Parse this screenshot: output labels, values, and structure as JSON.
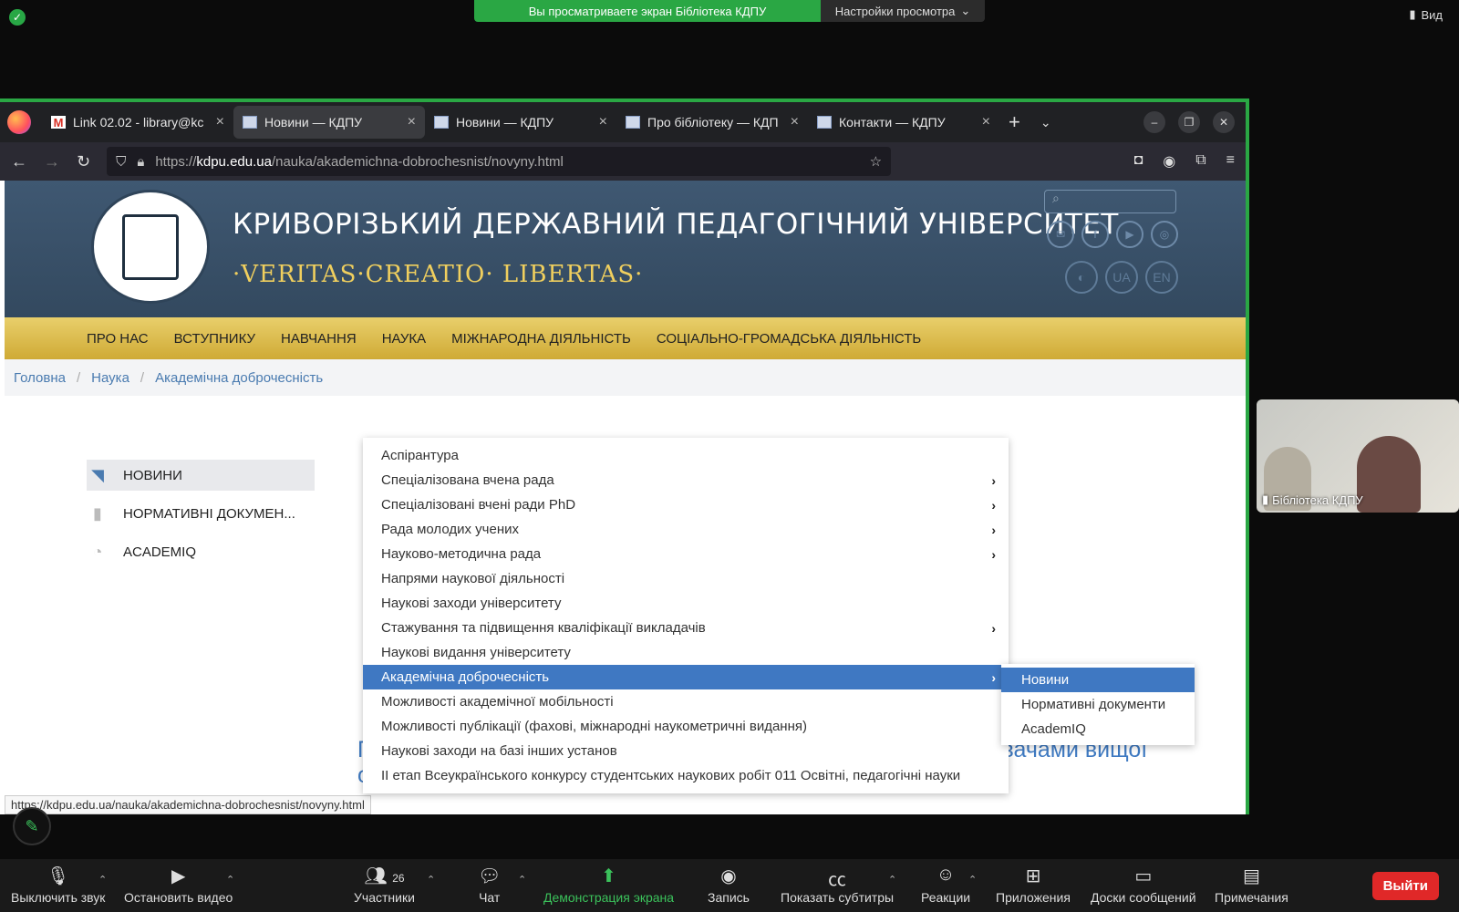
{
  "zoom": {
    "banner_text": "Вы просматриваете экран Бібліотека КДПУ",
    "settings_label": "Настройки просмотра",
    "view_label": "Вид",
    "toolbar": {
      "mute": "Выключить звук",
      "video": "Остановить видео",
      "participants": "Участники",
      "participants_count": "26",
      "chat": "Чат",
      "share": "Демонстрация экрана",
      "record": "Запись",
      "captions": "Показать субтитры",
      "reactions": "Реакции",
      "apps": "Приложения",
      "whiteboards": "Доски сообщений",
      "notes": "Примечания",
      "leave": "Выйти"
    },
    "video_tile_name": "Бібліотека КДПУ"
  },
  "browser": {
    "tabs": [
      {
        "title": "Link 02.02 - library@kc",
        "fav": "M"
      },
      {
        "title": "Новини — КДПУ",
        "fav": ""
      },
      {
        "title": "Новини — КДПУ",
        "fav": ""
      },
      {
        "title": "Про бібліотеку — КДП",
        "fav": ""
      },
      {
        "title": "Контакти — КДПУ",
        "fav": ""
      }
    ],
    "url_prefix": "https://",
    "url_host": "kdpu.edu.ua",
    "url_path": "/nauka/akademichna-dobrochesnist/novyny.html",
    "status_url": "https://kdpu.edu.ua/nauka/akademichna-dobrochesnist/novyny.html"
  },
  "site": {
    "university_title": "КРИВОРІЗЬКИЙ ДЕРЖАВНИЙ ПЕДАГОГІЧНИЙ УНІВЕРСИТЕТ",
    "motto": "·VERITAS·CREATIO· LIBERTAS·",
    "lang_ua": "UA",
    "lang_en": "EN",
    "menu": [
      "ПРО НАС",
      "ВСТУПНИКУ",
      "НАВЧАННЯ",
      "НАУКА",
      "МІЖНАРОДНА ДІЯЛЬНІСТЬ",
      "СОЦІАЛЬНО-ГРОМАДСЬКА ДІЯЛЬНІСТЬ"
    ],
    "breadcrumbs": [
      "Головна",
      "Наука",
      "Академічна доброчесність"
    ],
    "sidebar": [
      {
        "label": "НОВИНИ",
        "icon": "rss-icon"
      },
      {
        "label": "НОРМАТИВНІ ДОКУМЕН...",
        "icon": "document-icon"
      },
      {
        "label": "ACADEMIQ",
        "icon": "academiq-icon"
      }
    ],
    "article_title": "Про дотримання принципів академічної доброчесності здобувачами вищої освіти",
    "dropdown": [
      {
        "label": "Аспірантура",
        "sub": false
      },
      {
        "label": "Спеціалізована вчена рада",
        "sub": true
      },
      {
        "label": "Спеціалізовані вчені ради PhD",
        "sub": true
      },
      {
        "label": "Рада молодих учених",
        "sub": true
      },
      {
        "label": "Науково-методична рада",
        "sub": true
      },
      {
        "label": "Напрями наукової діяльності",
        "sub": false
      },
      {
        "label": "Наукові заходи університету",
        "sub": false
      },
      {
        "label": "Стажування та підвищення кваліфікації викладачів",
        "sub": true
      },
      {
        "label": "Наукові видання університету",
        "sub": false
      },
      {
        "label": "Академічна доброчесність",
        "sub": true,
        "active": true
      },
      {
        "label": "Можливості академічної мобільності",
        "sub": false
      },
      {
        "label": "Можливості публікації (фахові, міжнародні наукометричні видання)",
        "sub": false
      },
      {
        "label": "Наукові заходи на базі інших установ",
        "sub": false
      },
      {
        "label": "ІІ етап Всеукраїнського конкурсу студентських наукових робіт 011 Освітні, педагогічні науки",
        "sub": false
      }
    ],
    "submenu": [
      {
        "label": "Новини",
        "active": true
      },
      {
        "label": "Нормативні документи",
        "active": false
      },
      {
        "label": "AcademIQ",
        "active": false
      }
    ]
  },
  "colors": {
    "zoom_green": "#2aa744",
    "header_blue": "#3f5872",
    "menu_gold": "#cfaa35",
    "link_blue": "#3f78c2",
    "leave_red": "#e02828"
  }
}
